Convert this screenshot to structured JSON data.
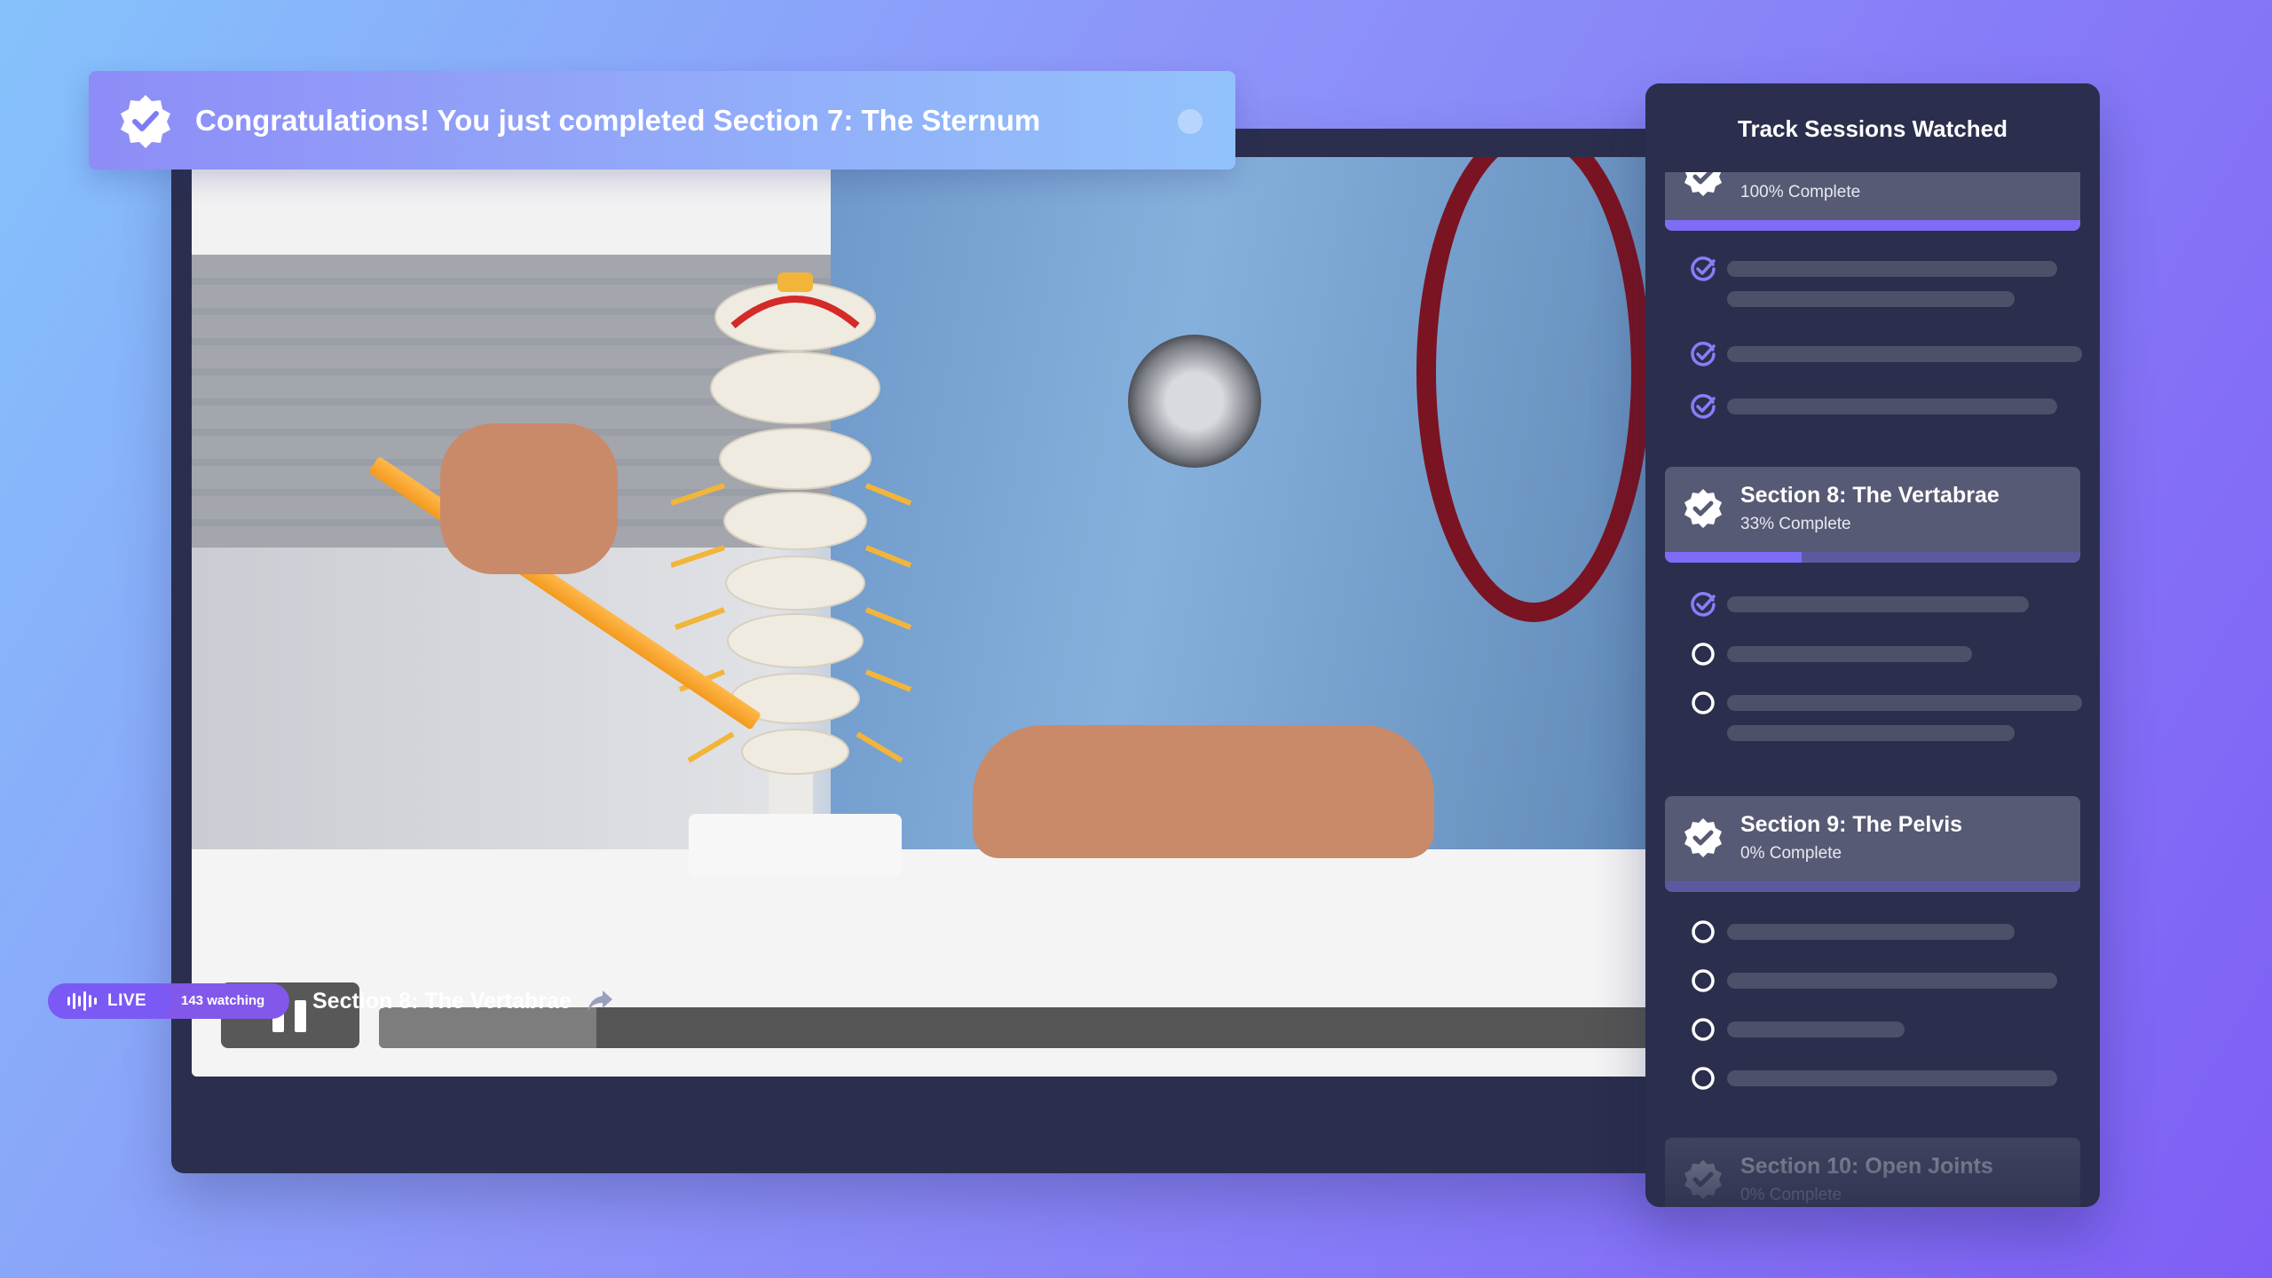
{
  "toast": {
    "message": "Congratulations! You just completed Section 7: The Sternum"
  },
  "player": {
    "progress_fraction": 0.17,
    "live_label": "LIVE",
    "watching_label": "143 watching",
    "now_playing_title": "Section 8: The Vertabrae"
  },
  "panel": {
    "title": "Track Sessions Watched",
    "sections": [
      {
        "name": "",
        "percent_label": "100% Complete",
        "percent": 100
      },
      {
        "name": "Section 8: The Vertabrae",
        "percent_label": "33% Complete",
        "percent": 33
      },
      {
        "name": "Section 9: The Pelvis",
        "percent_label": "0% Complete",
        "percent": 0
      },
      {
        "name": "Section 10: Open Joints",
        "percent_label": "0% Complete",
        "percent": 0
      }
    ]
  },
  "colors": {
    "accent": "#7f6cf6",
    "panel_bg": "#2b2f4d",
    "check_icon": "#8b7cf8"
  },
  "icons": [
    "verified-badge-icon",
    "close-icon",
    "pause-icon",
    "audio-wave-icon",
    "share-arrow-icon",
    "check-circle-icon",
    "empty-circle-icon"
  ]
}
